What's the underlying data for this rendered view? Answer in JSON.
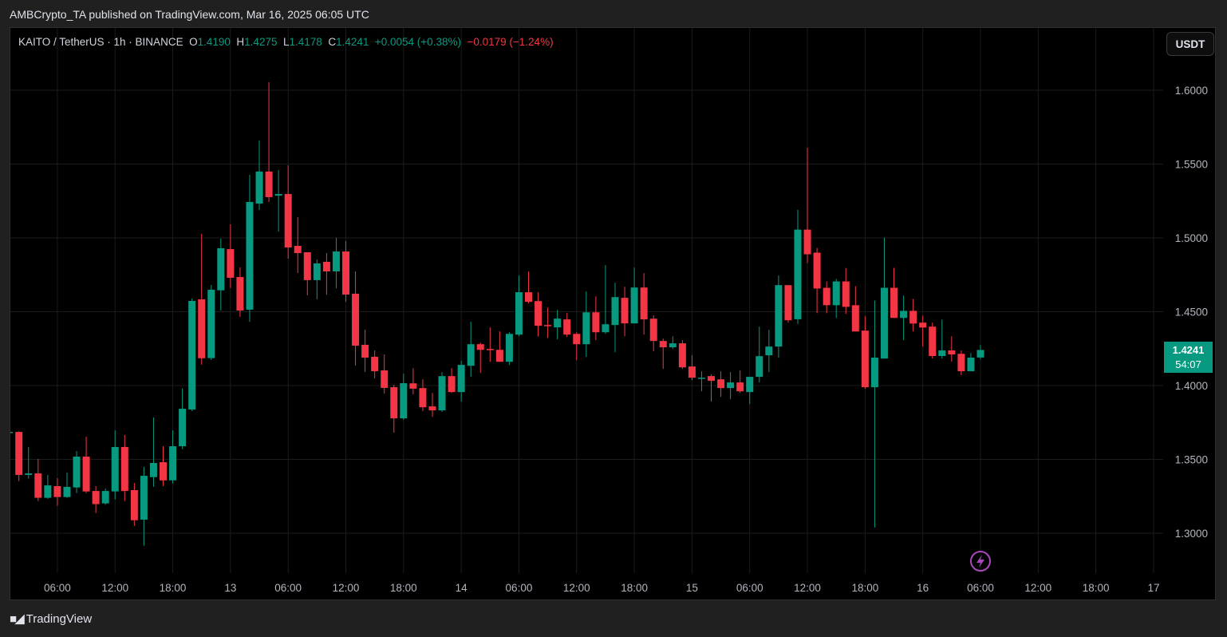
{
  "header": {
    "published": "AMBCrypto_TA published on TradingView.com, Mar 16, 2025 06:05 UTC",
    "symbol": "KAITO / TetherUS · 1h · BINANCE",
    "o_label": "O",
    "o_value": "1.4190",
    "h_label": "H",
    "h_value": "1.4275",
    "l_label": "L",
    "l_value": "1.4178",
    "c_label": "C",
    "c_value": "1.4241",
    "change": "+0.0054 (+0.38%)",
    "change2": "−0.0179 (−1.24%)"
  },
  "currency_button": "USDT",
  "last_price": {
    "price": "1.4241",
    "countdown": "54:07"
  },
  "footer": {
    "brand": "TradingView"
  },
  "colors": {
    "up": "#089981",
    "down": "#f23645",
    "grid": "#1c1c1c",
    "accent": "#ab47bc"
  },
  "chart_data": {
    "type": "candlestick",
    "interval": "1h",
    "ylim": [
      1.273,
      1.6427
    ],
    "grid": true,
    "y_ticks": [
      "1.3000",
      "1.3500",
      "1.4000",
      "1.4500",
      "1.5000",
      "1.5500",
      "1.6000"
    ],
    "x_ticks": [
      {
        "label": "06:00",
        "index": 5
      },
      {
        "label": "12:00",
        "index": 11
      },
      {
        "label": "18:00",
        "index": 17
      },
      {
        "label": "13",
        "index": 23
      },
      {
        "label": "06:00",
        "index": 29
      },
      {
        "label": "12:00",
        "index": 35
      },
      {
        "label": "18:00",
        "index": 41
      },
      {
        "label": "14",
        "index": 47
      },
      {
        "label": "06:00",
        "index": 53
      },
      {
        "label": "12:00",
        "index": 59
      },
      {
        "label": "18:00",
        "index": 65
      },
      {
        "label": "15",
        "index": 71
      },
      {
        "label": "06:00",
        "index": 77
      },
      {
        "label": "12:00",
        "index": 83
      },
      {
        "label": "18:00",
        "index": 89
      },
      {
        "label": "16",
        "index": 95
      },
      {
        "label": "06:00",
        "index": 101
      },
      {
        "label": "12:00",
        "index": 107
      },
      {
        "label": "18:00",
        "index": 113
      },
      {
        "label": "17",
        "index": 119
      }
    ],
    "ohlc_fields": [
      "open",
      "high",
      "low",
      "close"
    ],
    "candles": [
      [
        1.368,
        1.369,
        1.3678,
        1.3686
      ],
      [
        1.3686,
        1.369,
        1.3353,
        1.3395
      ],
      [
        1.3395,
        1.3584,
        1.337,
        1.3405
      ],
      [
        1.3405,
        1.3503,
        1.3218,
        1.324
      ],
      [
        1.324,
        1.3395,
        1.3233,
        1.3324
      ],
      [
        1.3319,
        1.3373,
        1.3186,
        1.3245
      ],
      [
        1.3245,
        1.3411,
        1.324,
        1.3314
      ],
      [
        1.331,
        1.3557,
        1.3272,
        1.3519
      ],
      [
        1.3519,
        1.3654,
        1.3272,
        1.3283
      ],
      [
        1.3286,
        1.3319,
        1.3137,
        1.3197
      ],
      [
        1.3202,
        1.3303,
        1.3192,
        1.3286
      ],
      [
        1.3283,
        1.3697,
        1.3229,
        1.3584
      ],
      [
        1.3584,
        1.3665,
        1.3218,
        1.3286
      ],
      [
        1.3292,
        1.334,
        1.305,
        1.3088
      ],
      [
        1.3092,
        1.3449,
        1.2915,
        1.3389
      ],
      [
        1.338,
        1.3784,
        1.3315,
        1.3476
      ],
      [
        1.3481,
        1.3589,
        1.332,
        1.3358
      ],
      [
        1.3358,
        1.3697,
        1.3337,
        1.3589
      ],
      [
        1.3589,
        1.398,
        1.3569,
        1.3843
      ],
      [
        1.3838,
        1.4589,
        1.3827,
        1.4573
      ],
      [
        1.4584,
        1.5027,
        1.4142,
        1.4185
      ],
      [
        1.4186,
        1.4681,
        1.4173,
        1.4649
      ],
      [
        1.4645,
        1.4995,
        1.4508,
        1.493
      ],
      [
        1.4924,
        1.5092,
        1.4661,
        1.473
      ],
      [
        1.4735,
        1.48,
        1.4465,
        1.4508
      ],
      [
        1.4514,
        1.5427,
        1.4432,
        1.5243
      ],
      [
        1.5232,
        1.5659,
        1.5189,
        1.5449
      ],
      [
        1.5449,
        1.6054,
        1.5243,
        1.5276
      ],
      [
        1.5286,
        1.5459,
        1.5043,
        1.5297
      ],
      [
        1.5297,
        1.5492,
        1.4859,
        1.4935
      ],
      [
        1.4946,
        1.5141,
        1.4762,
        1.4897
      ],
      [
        1.4903,
        1.4903,
        1.4611,
        1.4714
      ],
      [
        1.4714,
        1.4854,
        1.4584,
        1.4827
      ],
      [
        1.4838,
        1.4897,
        1.4616,
        1.4773
      ],
      [
        1.4773,
        1.5,
        1.4659,
        1.4908
      ],
      [
        1.4908,
        1.4978,
        1.4568,
        1.4616
      ],
      [
        1.4622,
        1.4773,
        1.4135,
        1.427
      ],
      [
        1.4276,
        1.4378,
        1.4092,
        1.4189
      ],
      [
        1.4195,
        1.4238,
        1.4049,
        1.4097
      ],
      [
        1.4103,
        1.4211,
        1.3946,
        1.3984
      ],
      [
        1.3989,
        1.4005,
        1.3681,
        1.3778
      ],
      [
        1.3778,
        1.4081,
        1.3768,
        1.4016
      ],
      [
        1.4015,
        1.4118,
        1.3941,
        1.3979
      ],
      [
        1.3983,
        1.4042,
        1.3826,
        1.3853
      ],
      [
        1.3859,
        1.395,
        1.3788,
        1.3832
      ],
      [
        1.3832,
        1.4091,
        1.3821,
        1.4064
      ],
      [
        1.4064,
        1.4118,
        1.395,
        1.3956
      ],
      [
        1.3956,
        1.4167,
        1.3891,
        1.414
      ],
      [
        1.4134,
        1.4432,
        1.4059,
        1.428
      ],
      [
        1.428,
        1.4291,
        1.4086,
        1.4242
      ],
      [
        1.4248,
        1.4394,
        1.4161,
        1.4242
      ],
      [
        1.4242,
        1.4367,
        1.4161,
        1.4161
      ],
      [
        1.4161,
        1.4361,
        1.414,
        1.435
      ],
      [
        1.4345,
        1.4745,
        1.4334,
        1.4632
      ],
      [
        1.4632,
        1.4772,
        1.4556,
        1.4567
      ],
      [
        1.4572,
        1.4632,
        1.4334,
        1.4405
      ],
      [
        1.441,
        1.4529,
        1.4323,
        1.4406
      ],
      [
        1.4394,
        1.4513,
        1.4313,
        1.4453
      ],
      [
        1.4448,
        1.4491,
        1.4329,
        1.4345
      ],
      [
        1.435,
        1.4361,
        1.4172,
        1.428
      ],
      [
        1.428,
        1.4637,
        1.4194,
        1.4496
      ],
      [
        1.4496,
        1.4605,
        1.4307,
        1.4361
      ],
      [
        1.4361,
        1.4815,
        1.435,
        1.4415
      ],
      [
        1.441,
        1.4696,
        1.4226,
        1.4599
      ],
      [
        1.4594,
        1.4669,
        1.4334,
        1.4421
      ],
      [
        1.4421,
        1.4799,
        1.4421,
        1.4664
      ],
      [
        1.4664,
        1.4761,
        1.4345,
        1.4448
      ],
      [
        1.4453,
        1.4475,
        1.4232,
        1.4302
      ],
      [
        1.4302,
        1.4318,
        1.4113,
        1.4259
      ],
      [
        1.4259,
        1.4334,
        1.4248,
        1.4286
      ],
      [
        1.4286,
        1.4307,
        1.4113,
        1.4123
      ],
      [
        1.4129,
        1.4205,
        1.4037,
        1.4053
      ],
      [
        1.4049,
        1.4096,
        1.3961,
        1.4053
      ],
      [
        1.4064,
        1.4075,
        1.3891,
        1.4032
      ],
      [
        1.4042,
        1.4096,
        1.3923,
        1.3983
      ],
      [
        1.3983,
        1.4091,
        1.3907,
        1.4021
      ],
      [
        1.4021,
        1.4102,
        1.395,
        1.3961
      ],
      [
        1.3956,
        1.4059,
        1.3875,
        1.4059
      ],
      [
        1.4059,
        1.4399,
        1.4021,
        1.4199
      ],
      [
        1.4205,
        1.4377,
        1.4091,
        1.4264
      ],
      [
        1.4264,
        1.4745,
        1.4188,
        1.468
      ],
      [
        1.468,
        1.468,
        1.4426,
        1.4442
      ],
      [
        1.4449,
        1.519,
        1.4417,
        1.5056
      ],
      [
        1.5056,
        1.561,
        1.4829,
        1.4889
      ],
      [
        1.49,
        1.4932,
        1.449,
        1.4657
      ],
      [
        1.4662,
        1.4705,
        1.449,
        1.4544
      ],
      [
        1.4544,
        1.4722,
        1.4458,
        1.4705
      ],
      [
        1.4705,
        1.4796,
        1.4485,
        1.4533
      ],
      [
        1.4544,
        1.4673,
        1.4366,
        1.4366
      ],
      [
        1.4372,
        1.4469,
        1.3978,
        1.3989
      ],
      [
        1.3989,
        1.4576,
        1.3039,
        1.4189
      ],
      [
        1.4183,
        1.5002,
        1.4183,
        1.4662
      ],
      [
        1.4662,
        1.4797,
        1.4458,
        1.4458
      ],
      [
        1.4458,
        1.4609,
        1.4307,
        1.4506
      ],
      [
        1.4506,
        1.4587,
        1.4366,
        1.442
      ],
      [
        1.4426,
        1.4474,
        1.4264,
        1.4393
      ],
      [
        1.4399,
        1.4426,
        1.4183,
        1.42
      ],
      [
        1.42,
        1.4447,
        1.4183,
        1.4238
      ],
      [
        1.4238,
        1.4334,
        1.4162,
        1.4211
      ],
      [
        1.4215,
        1.4238,
        1.407,
        1.4097
      ],
      [
        1.4097,
        1.422,
        1.4097,
        1.4189
      ],
      [
        1.419,
        1.4275,
        1.4178,
        1.4241
      ]
    ]
  }
}
